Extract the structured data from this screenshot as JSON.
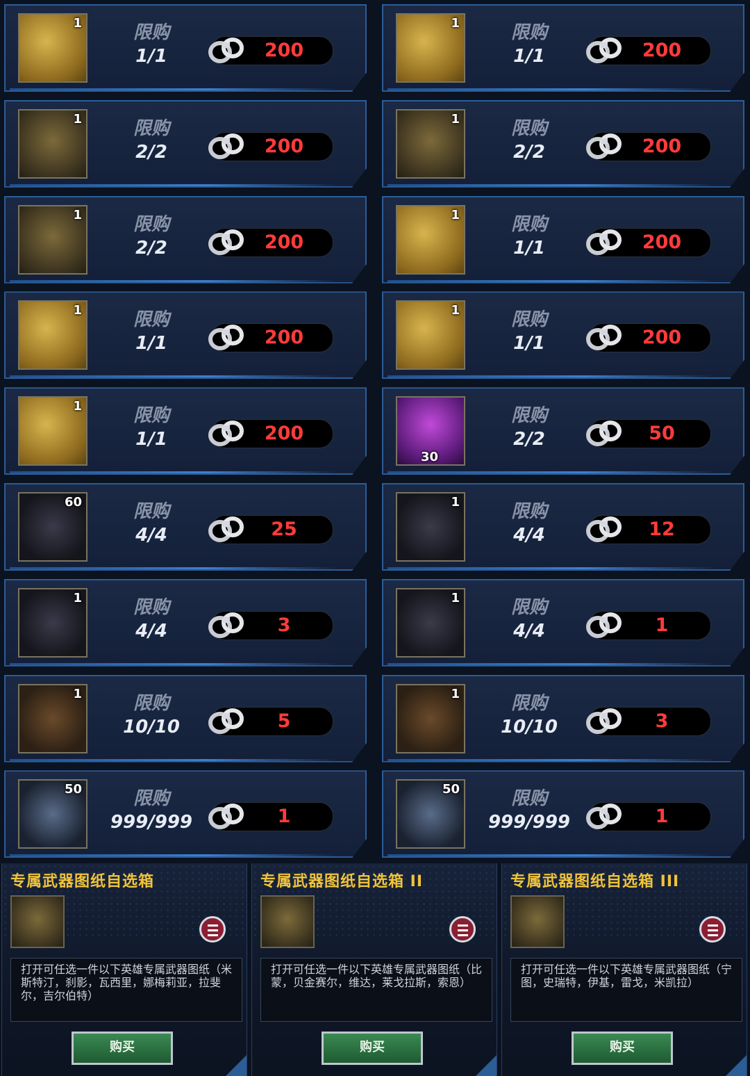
{
  "limit_label": "限购",
  "items": [
    {
      "qty": "1",
      "limit": "1/1",
      "price": "200",
      "icon": "weapon-blueprint-icon",
      "style": "gold"
    },
    {
      "qty": "1",
      "limit": "1/1",
      "price": "200",
      "icon": "weapon-blueprint-icon",
      "style": "gold"
    },
    {
      "qty": "1",
      "limit": "2/2",
      "price": "200",
      "icon": "blueprint-chest-icon",
      "style": "chest"
    },
    {
      "qty": "1",
      "limit": "2/2",
      "price": "200",
      "icon": "blueprint-chest-icon",
      "style": "chest"
    },
    {
      "qty": "1",
      "limit": "2/2",
      "price": "200",
      "icon": "blueprint-chest-icon",
      "style": "chest"
    },
    {
      "qty": "1",
      "limit": "1/1",
      "price": "200",
      "icon": "weapon-blueprint-icon",
      "style": "gold"
    },
    {
      "qty": "1",
      "limit": "1/1",
      "price": "200",
      "icon": "weapon-blueprint-icon",
      "style": "gold"
    },
    {
      "qty": "1",
      "limit": "1/1",
      "price": "200",
      "icon": "weapon-blueprint-icon",
      "style": "gold"
    },
    {
      "qty": "1",
      "limit": "1/1",
      "price": "200",
      "icon": "weapon-blueprint-icon",
      "style": "gold"
    },
    {
      "qty": "30",
      "limit": "2/2",
      "price": "50",
      "icon": "hero-portrait-icon",
      "style": "purple"
    },
    {
      "qty": "60",
      "limit": "4/4",
      "price": "25",
      "icon": "purple-orb-icon",
      "style": "dark"
    },
    {
      "qty": "1",
      "limit": "4/4",
      "price": "12",
      "icon": "red-bottlecap-icon",
      "style": "dark"
    },
    {
      "qty": "1",
      "limit": "4/4",
      "price": "3",
      "icon": "pink-bottlecap-icon",
      "style": "dark"
    },
    {
      "qty": "1",
      "limit": "4/4",
      "price": "1",
      "icon": "poker-chip-icon",
      "style": "dark"
    },
    {
      "qty": "1",
      "limit": "10/10",
      "price": "5",
      "icon": "propeller-medal-icon",
      "style": "brown"
    },
    {
      "qty": "1",
      "limit": "10/10",
      "price": "3",
      "icon": "orange-crystal-icon",
      "style": "brown"
    },
    {
      "qty": "50",
      "limit": "999/999",
      "price": "1",
      "icon": "silver-prism-icon",
      "style": "blue"
    },
    {
      "qty": "50",
      "limit": "999/999",
      "price": "1",
      "icon": "gear-icon",
      "style": "blue"
    }
  ],
  "packs": [
    {
      "title": "专属武器图纸自选箱",
      "desc": "打开可任选一件以下英雄专属武器图纸（米斯特汀，刹影，瓦西里，娜梅莉亚，拉斐尔，吉尔伯特）",
      "buy": "购买"
    },
    {
      "title": "专属武器图纸自选箱 II",
      "desc": "打开可任选一件以下英雄专属武器图纸（比蒙，贝金赛尔，维达，莱戈拉斯，索恩）",
      "buy": "购买"
    },
    {
      "title": "专属武器图纸自选箱 III",
      "desc": "打开可任选一件以下英雄专属武器图纸（宁图，史瑞特，伊基，雷戈，米凯拉）",
      "buy": "购买"
    }
  ],
  "colors": {
    "price": "#ff3b3b",
    "title": "#f0c33a",
    "border": "#2b5d97",
    "buy": "#2f7a46"
  }
}
